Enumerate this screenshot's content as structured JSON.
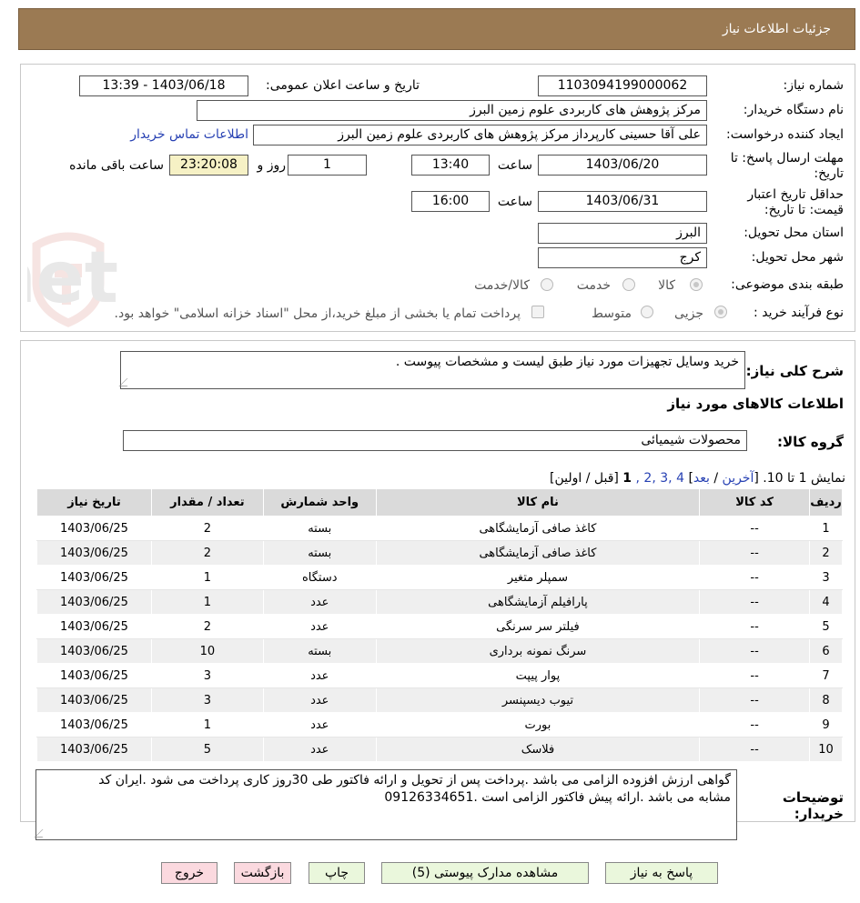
{
  "header": {
    "title": "جزئیات اطلاعات نیاز"
  },
  "form": {
    "need_number_label": "شماره نیاز:",
    "need_number": "1103094199000062",
    "announce_label": "تاریخ و ساعت اعلان عمومی:",
    "announce_value": "1403/06/18 - 13:39",
    "buyer_org_label": "نام دستگاه خریدار:",
    "buyer_org": "مرکز پژوهش های کاربردی علوم زمین البرز",
    "creator_label": "ایجاد کننده درخواست:",
    "creator": "علی آقا حسینی کارپرداز مرکز پژوهش های کاربردی علوم زمین البرز",
    "contact_link": "اطلاعات تماس خریدار",
    "deadline_label_1": "مهلت ارسال پاسخ: تا",
    "deadline_label_2": "تاریخ:",
    "deadline_date": "1403/06/20",
    "time_label": "ساعت",
    "deadline_time": "13:40",
    "days_value": "1",
    "days_label": "روز و",
    "remaining_value": "23:20:08",
    "remaining_label": "ساعت باقی مانده",
    "validity_label_1": "حداقل تاریخ اعتبار",
    "validity_label_2": "قیمت: تا تاریخ:",
    "validity_date": "1403/06/31",
    "validity_time": "16:00",
    "province_label": "استان محل تحویل:",
    "province": "البرز",
    "city_label": "شهر محل تحویل:",
    "city": "کرج",
    "category_label": "طبقه بندی موضوعی:",
    "category_options": [
      "کالا",
      "خدمت",
      "کالا/خدمت"
    ],
    "purchase_type_label": "نوع فرآیند خرید :",
    "purchase_options": [
      "جزیی",
      "متوسط"
    ],
    "payment_note": "پرداخت تمام یا بخشی از مبلغ خرید،از محل \"اسناد خزانه اسلامی\" خواهد بود."
  },
  "summary": {
    "desc_label": "شرح کلی نیاز:",
    "desc_value": "خرید وسایل تجهیزات مورد نیاز طبق لیست و مشخصات پیوست .",
    "goods_info_title": "اطلاعات کالاهای مورد نیاز",
    "group_label": "گروه کالا:",
    "group_value": "محصولات شیمیائی"
  },
  "pagination": {
    "showing": "نمایش 1 تا 10.",
    "open": "[",
    "last": "آخرین",
    "sep": " / ",
    "next": "بعد",
    "close": "]",
    "pages": "4 ,3 ,2 ,",
    "current": "1",
    "prev_first": "[قبل / اولین]"
  },
  "table": {
    "headers": [
      "ردیف",
      "کد کالا",
      "نام کالا",
      "واحد شمارش",
      "تعداد / مقدار",
      "تاریخ نیاز"
    ],
    "rows": [
      [
        "1",
        "--",
        "کاغذ صافی آزمایشگاهی",
        "بسته",
        "2",
        "1403/06/25"
      ],
      [
        "2",
        "--",
        "کاغذ صافی آزمایشگاهی",
        "بسته",
        "2",
        "1403/06/25"
      ],
      [
        "3",
        "--",
        "سمپلر متغیر",
        "دستگاه",
        "1",
        "1403/06/25"
      ],
      [
        "4",
        "--",
        "پارافیلم آزمایشگاهی",
        "عدد",
        "1",
        "1403/06/25"
      ],
      [
        "5",
        "--",
        "فیلتر سر سرنگی",
        "عدد",
        "2",
        "1403/06/25"
      ],
      [
        "6",
        "--",
        "سرنگ نمونه برداری",
        "بسته",
        "10",
        "1403/06/25"
      ],
      [
        "7",
        "--",
        "پوار پیپت",
        "عدد",
        "3",
        "1403/06/25"
      ],
      [
        "8",
        "--",
        "تیوب دیسپنسر",
        "عدد",
        "3",
        "1403/06/25"
      ],
      [
        "9",
        "--",
        "بورت",
        "عدد",
        "1",
        "1403/06/25"
      ],
      [
        "10",
        "--",
        "فلاسک",
        "عدد",
        "5",
        "1403/06/25"
      ]
    ]
  },
  "notes": {
    "label_1": "توضیحات",
    "label_2": "خریدار:",
    "text_1": "گواهی ارزش افزوده الزامی می باشد .پرداخت پس از تحویل  و ارائه فاکتور طی 30روز کاری پرداخت می شود .ایران کد",
    "text_2": "مشابه می باشد .ارائه پیش فاکتور الزامی است .09126334651"
  },
  "buttons": {
    "reply": "پاسخ به نیاز",
    "attachments": "مشاهده مدارک پیوستی (5)",
    "print": "چاپ",
    "back": "بازگشت",
    "exit": "خروج"
  },
  "watermark": {
    "text": "AriaTender.net"
  }
}
